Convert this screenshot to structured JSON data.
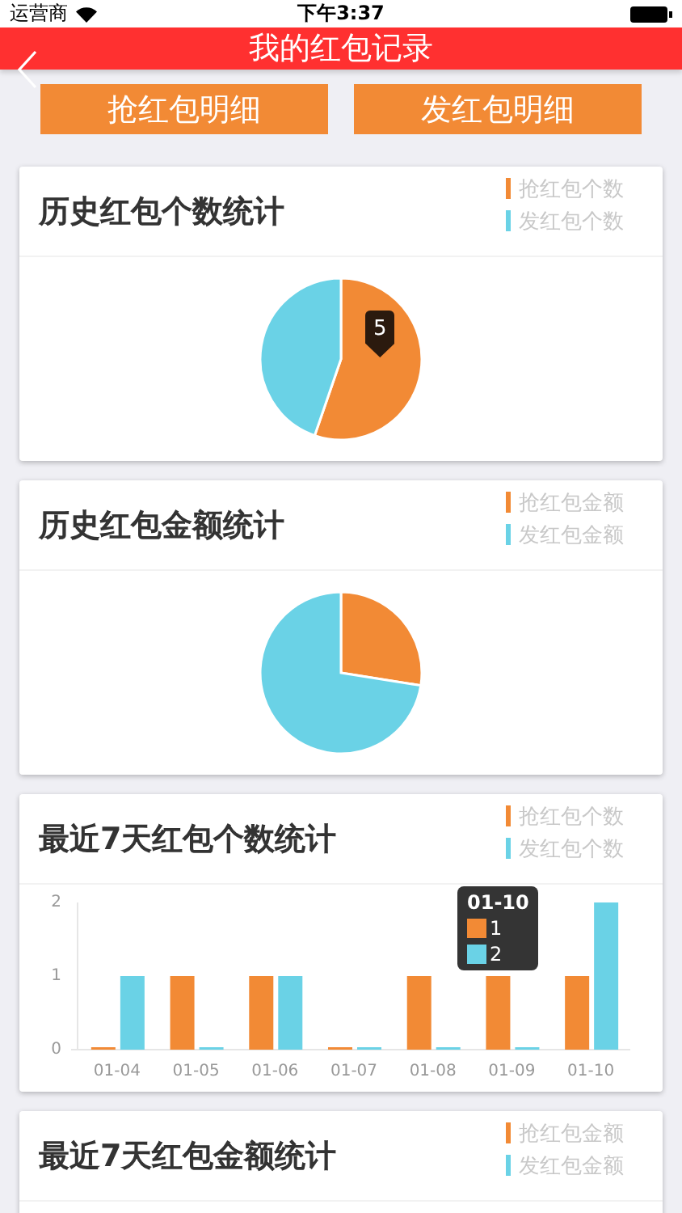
{
  "status_bar": {
    "carrier": "运营商",
    "time": "下午3:37"
  },
  "nav": {
    "title": "我的红包记录"
  },
  "buttons": [
    "抢红包明细",
    "发红包明细"
  ],
  "cards": [
    {
      "kind": "pie",
      "title": "历史红包个数统计",
      "legend": [
        {
          "label": "抢红包个数",
          "color": "#f28a35"
        },
        {
          "label": "发红包个数",
          "color": "#6ad2e6"
        }
      ],
      "tooltip": "5"
    },
    {
      "kind": "pie",
      "title": "历史红包金额统计",
      "legend": [
        {
          "label": "抢红包金额",
          "color": "#f28a35"
        },
        {
          "label": "发红包金额",
          "color": "#6ad2e6"
        }
      ]
    },
    {
      "kind": "bar",
      "title": "最近7天红包个数统计",
      "chart_data": {
        "type": "bar",
        "categories": [
          "01-04",
          "01-05",
          "01-06",
          "01-07",
          "01-08",
          "01-09",
          "01-10"
        ],
        "series": [
          {
            "name": "抢红包个数",
            "color": "#f28a35",
            "values": [
              0,
              1,
              1,
              0,
              1,
              1,
              1
            ]
          },
          {
            "name": "发红包个数",
            "color": "#6ad2e6",
            "values": [
              1,
              0,
              1,
              0,
              0,
              0,
              2
            ]
          }
        ],
        "ylim": [
          0,
          2
        ],
        "yticks": [
          0,
          1,
          2
        ]
      },
      "tooltip": {
        "title": "01-10",
        "items": [
          "1",
          "2"
        ]
      }
    },
    {
      "kind": "partial",
      "title": "最近7天红包金额统计",
      "legend": [
        {
          "label": "抢红包金额",
          "color": "#f28a35"
        },
        {
          "label": "发红包金额",
          "color": "#6ad2e6"
        }
      ]
    }
  ]
}
